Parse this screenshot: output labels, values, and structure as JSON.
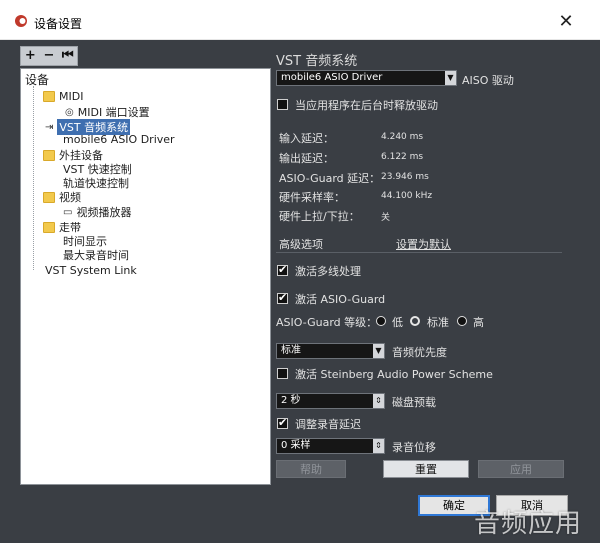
{
  "window": {
    "title": "设备设置",
    "close_glyph": "✕"
  },
  "tree": {
    "toolbar": {
      "add": "+",
      "remove": "−",
      "reset": "⏮"
    },
    "root": "设备",
    "items": [
      {
        "label": "MIDI",
        "icon": "folder-icon"
      },
      {
        "label": "MIDI 端口设置",
        "icon": "midi-port-icon"
      },
      {
        "label": "VST 音频系统",
        "icon": "audio-system-icon",
        "selected": true
      },
      {
        "label": "mobile6 ASIO Driver",
        "icon": ""
      },
      {
        "label": "外挂设备",
        "icon": "folder-icon"
      },
      {
        "label": "VST 快速控制",
        "icon": ""
      },
      {
        "label": "轨道快速控制",
        "icon": ""
      },
      {
        "label": "视频",
        "icon": "folder-icon"
      },
      {
        "label": "视频播放器",
        "icon": "video-player-icon"
      },
      {
        "label": "走带",
        "icon": "folder-icon"
      },
      {
        "label": "时间显示",
        "icon": ""
      },
      {
        "label": "最大录音时间",
        "icon": ""
      },
      {
        "label": "VST System Link",
        "icon": ""
      }
    ]
  },
  "panel": {
    "title": "VST 音频系统",
    "driver_value": "mobile6 ASIO Driver",
    "driver_label": "AISO 驱动",
    "release_driver_label": "当应用程序在后台时释放驱动",
    "stats": [
      {
        "label": "输入延迟：",
        "value": "4.240 ms"
      },
      {
        "label": "输出延迟：",
        "value": "6.122 ms"
      },
      {
        "label": "ASIO-Guard 延迟：",
        "value": "23.946 ms"
      },
      {
        "label": "硬件采样率：",
        "value": "44.100 kHz"
      },
      {
        "label": "硬件上拉/下拉：",
        "value": "关"
      }
    ],
    "advanced_label": "高级选项",
    "set_default_label": "设置为默认",
    "multi_processing_label": "激活多线处理",
    "asio_guard_label": "激活 ASIO-Guard",
    "asio_guard_level_label": "ASIO-Guard 等级：",
    "levels": [
      "低",
      "标准",
      "高"
    ],
    "priority_value": "标准",
    "priority_label": "音频优先度",
    "power_scheme_label": "激活 Steinberg Audio Power Scheme",
    "preload_value": "2 秒",
    "preload_label": "磁盘预载",
    "adjust_latency_label": "调整录音延迟",
    "offset_value": "0 采样",
    "offset_label": "录音位移",
    "help_button": "帮助",
    "reset_button": "重置",
    "apply_button": "应用"
  },
  "footer": {
    "ok": "确定",
    "cancel": "取消"
  },
  "watermark": "音频应用"
}
